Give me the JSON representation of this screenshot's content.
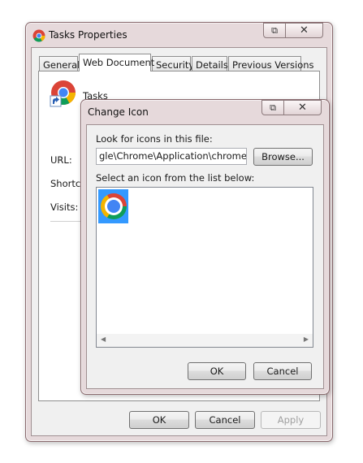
{
  "props": {
    "title": "Tasks Properties",
    "tabs": [
      "General",
      "Web Document",
      "Security",
      "Details",
      "Previous Versions"
    ],
    "shortcut_name": "Tasks",
    "fields": {
      "url": "URL:",
      "shortcut": "Shortcut",
      "visits": "Visits:"
    },
    "buttons": {
      "ok": "OK",
      "cancel": "Cancel",
      "apply": "Apply"
    }
  },
  "dialog": {
    "title": "Change Icon",
    "look_label": "Look for icons in this file:",
    "file_path": "gle\\Chrome\\Application\\chrome.exe",
    "browse": "Browse...",
    "select_label": "Select an icon from the list below:",
    "buttons": {
      "ok": "OK",
      "cancel": "Cancel"
    }
  },
  "icons": {
    "restore": "restore-icon",
    "close": "close-icon",
    "app": "chrome-icon",
    "scroll_left": "scroll-left-icon",
    "scroll_right": "scroll-right-icon"
  },
  "colors": {
    "frame": "#e6d9db",
    "selection": "#3399ff"
  }
}
